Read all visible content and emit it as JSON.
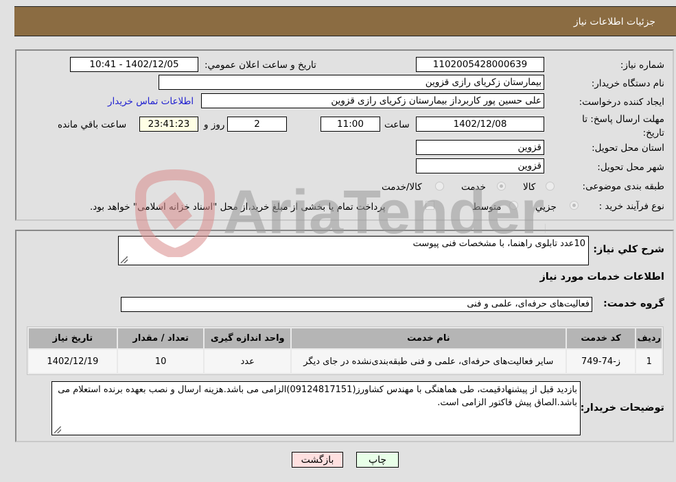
{
  "header": {
    "title": "جزئیات اطلاعات نیاز"
  },
  "fields": {
    "need_number_label": "شماره نیاز:",
    "need_number": "1102005428000639",
    "announce_label": "تاریخ و ساعت اعلان عمومي:",
    "announce_value": "1402/12/05 - 10:41",
    "buyer_org_label": "نام دستگاه خریدار:",
    "buyer_org": "بیمارستان زکریای رازی قزوین",
    "creator_label": "ایجاد کننده درخواست:",
    "creator": "علی حسین پور کاربرداز بیمارستان زکریای رازی قزوین",
    "contact_link": "اطلاعات تماس خریدار",
    "deadline_label": "مهلت ارسال پاسخ: تا تاریخ:",
    "deadline_date": "1402/12/08",
    "time_label": "ساعت",
    "deadline_time": "11:00",
    "days": "2",
    "days_label": "روز و",
    "remaining": "23:41:23",
    "remaining_label": "ساعت باقي مانده",
    "province_label": "استان محل تحویل:",
    "province": "قزوین",
    "city_label": "شهر محل تحویل:",
    "city": "قزوین",
    "category_label": "طبقه بندی موضوعی:",
    "category_options": [
      "کالا",
      "خدمت",
      "کالا/خدمت"
    ],
    "category_selected": "خدمت",
    "purchase_type_label": "نوع فرآیند خرید :",
    "purchase_type_options": [
      "جزيي",
      "متوسط"
    ],
    "purchase_type_selected": "جزيي",
    "treasury_note": "پرداخت تمام یا بخشی از مبلغ خرید،از محل \"اسناد خزانه اسلامی\" خواهد بود."
  },
  "details": {
    "general_desc_label": "شرح کلي نیاز:",
    "general_desc": "10عدد تابلوی راهنما، با مشخصات فنی پیوست",
    "services_heading": "اطلاعات خدمات مورد نیاز",
    "service_group_label": "گروه خدمت:",
    "service_group": "فعالیت‌های حرفه‌ای، علمی و فنی",
    "table": {
      "headers": [
        "ردیف",
        "کد خدمت",
        "نام خدمت",
        "واحد اندازه گیری",
        "تعداد / مقدار",
        "تاریخ نیاز"
      ],
      "rows": [
        [
          "1",
          "ز-74-749",
          "سایر فعالیت‌های حرفه‌ای، علمی و فنی طبقه‌بندی‌نشده در جای دیگر",
          "عدد",
          "10",
          "1402/12/19"
        ]
      ]
    },
    "buyer_notes_label": "توضیحات خریدار:",
    "buyer_notes": "بازدید قبل از پیشنهادقیمت، طی هماهنگی با مهندس کشاورز(09124817151)الزامی می باشد.هزینه ارسال و نصب بعهده برنده استعلام می باشد.الصاق پیش فاکتور الزامی است."
  },
  "buttons": {
    "print": "چاپ",
    "back": "بازگشت"
  },
  "watermark": {
    "text": "AriaTender.net"
  },
  "colors": {
    "header_bg": "#8b6c42",
    "back_bg": "#ffe0e0",
    "print_bg": "#e8ffe8",
    "link": "#2020d0"
  }
}
